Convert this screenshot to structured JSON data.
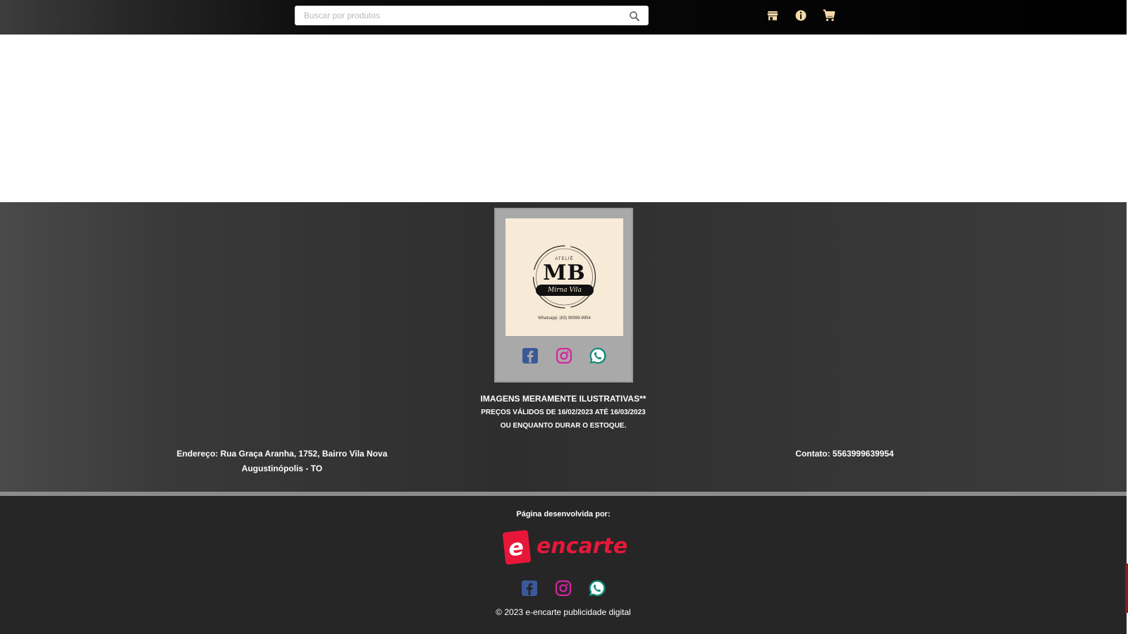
{
  "header": {
    "search": {
      "placeholder": "Buscar por produtos",
      "value": ""
    },
    "icons": [
      "store-icon",
      "info-icon",
      "cart-icon"
    ],
    "text_color": "#f5d9a8"
  },
  "store": {
    "logo": {
      "monogram": "MB",
      "script_name": "Mirna Vila",
      "top_text": "ATELIÊ",
      "bottom_text": "Whatsapp: (63) 99999-9954"
    },
    "social_icons": [
      "facebook-icon",
      "instagram-icon",
      "whatsapp-icon"
    ],
    "notice": {
      "line1": "IMAGENS MERAMENTE ILUSTRATIVAS**",
      "line2": "PREÇOS VÁLIDOS DE 16/02/2023 ATÉ 16/03/2023",
      "line3": "OU ENQUANTO DURAR O ESTOQUE."
    },
    "address_line1": "Endereço: Rua Graça Aranha, 1752, Bairro Vila Nova",
    "address_line2": "Augustinópolis - TO",
    "contact": "Contato: 5563999639954"
  },
  "credit": {
    "label": "Página desenvolvida por:",
    "brand_mark": "e",
    "brand_name": "encarte",
    "brand_color": "#e8173a",
    "copyright": "© 2023 e-encarte publicidade digital"
  },
  "colors": {
    "facebook": "#3b5998",
    "instagram": "#d6249f",
    "whatsapp": "#128c7e"
  }
}
